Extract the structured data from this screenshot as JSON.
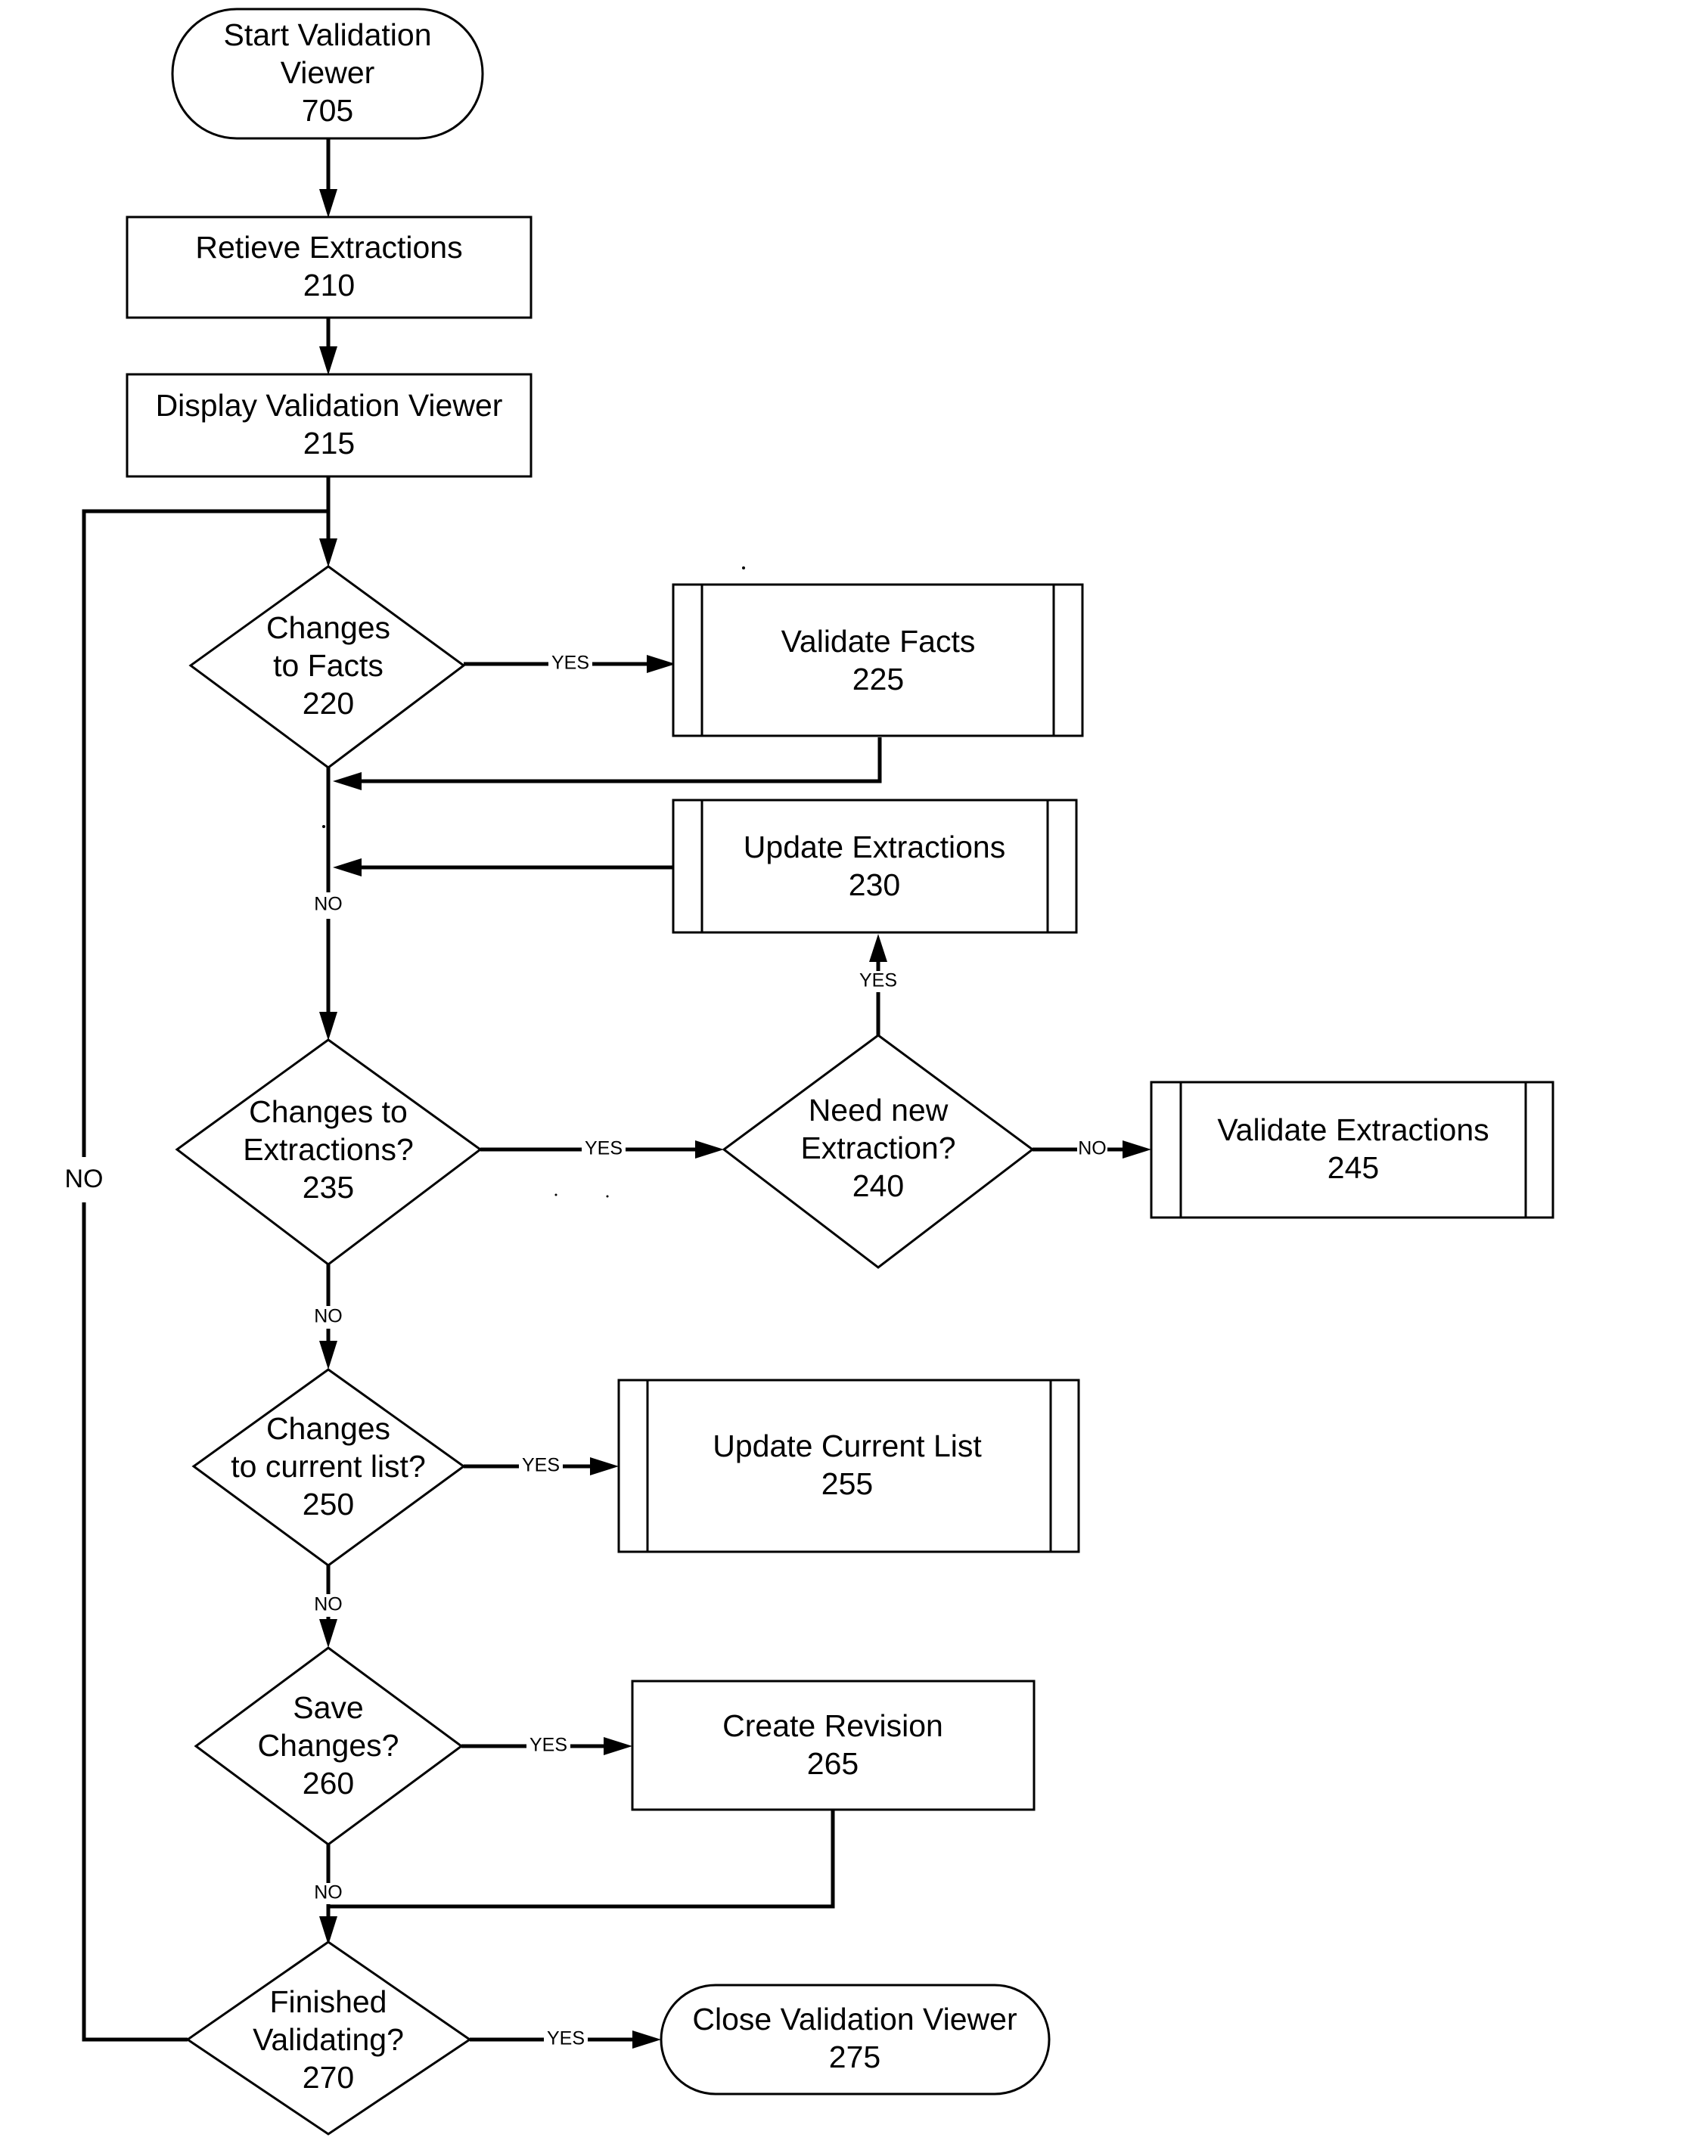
{
  "diagram": {
    "type": "flowchart",
    "nodes": {
      "start": {
        "id": "705",
        "shape": "terminator",
        "lines": [
          "Start Validation",
          "Viewer",
          "705"
        ]
      },
      "retrieve": {
        "id": "210",
        "shape": "process",
        "lines": [
          "Retieve Extractions",
          "210"
        ]
      },
      "display": {
        "id": "215",
        "shape": "process",
        "lines": [
          "Display Validation Viewer",
          "215"
        ]
      },
      "facts_q": {
        "id": "220",
        "shape": "decision",
        "lines": [
          "Changes",
          "to Facts",
          "220"
        ]
      },
      "validate_facts": {
        "id": "225",
        "shape": "predefined-process",
        "lines": [
          "Validate Facts",
          "225"
        ]
      },
      "update_extractions": {
        "id": "230",
        "shape": "predefined-process",
        "lines": [
          "Update Extractions",
          "230"
        ]
      },
      "extractions_q": {
        "id": "235",
        "shape": "decision",
        "lines": [
          "Changes to",
          "Extractions?",
          "235"
        ]
      },
      "need_new_q": {
        "id": "240",
        "shape": "decision",
        "lines": [
          "Need new",
          "Extraction?",
          "240"
        ]
      },
      "validate_extractions": {
        "id": "245",
        "shape": "predefined-process",
        "lines": [
          "Validate Extractions",
          "245"
        ]
      },
      "list_q": {
        "id": "250",
        "shape": "decision",
        "lines": [
          "Changes",
          "to current list?",
          "250"
        ]
      },
      "update_list": {
        "id": "255",
        "shape": "predefined-process",
        "lines": [
          "Update Current List",
          "255"
        ]
      },
      "save_q": {
        "id": "260",
        "shape": "decision",
        "lines": [
          "Save",
          "Changes?",
          "260"
        ]
      },
      "create_revision": {
        "id": "265",
        "shape": "process",
        "lines": [
          "Create Revision",
          "265"
        ]
      },
      "finished_q": {
        "id": "270",
        "shape": "decision",
        "lines": [
          "Finished",
          "Validating?",
          "270"
        ]
      },
      "close": {
        "id": "275",
        "shape": "terminator",
        "lines": [
          "Close Validation Viewer",
          "275"
        ]
      }
    },
    "edges": [
      {
        "from": "705",
        "to": "210",
        "label": ""
      },
      {
        "from": "210",
        "to": "215",
        "label": ""
      },
      {
        "from": "215",
        "to": "220",
        "label": ""
      },
      {
        "from": "220",
        "to": "225",
        "label": "YES"
      },
      {
        "from": "225",
        "to": "235",
        "label": ""
      },
      {
        "from": "220",
        "to": "235",
        "label": "NO"
      },
      {
        "from": "230",
        "to": "235",
        "label": ""
      },
      {
        "from": "235",
        "to": "240",
        "label": "YES"
      },
      {
        "from": "240",
        "to": "230",
        "label": "YES"
      },
      {
        "from": "240",
        "to": "245",
        "label": "NO"
      },
      {
        "from": "235",
        "to": "250",
        "label": "NO"
      },
      {
        "from": "250",
        "to": "255",
        "label": "YES"
      },
      {
        "from": "250",
        "to": "260",
        "label": "NO"
      },
      {
        "from": "260",
        "to": "265",
        "label": "YES"
      },
      {
        "from": "260",
        "to": "270",
        "label": "NO"
      },
      {
        "from": "265",
        "to": "270",
        "label": ""
      },
      {
        "from": "270",
        "to": "275",
        "label": "YES"
      },
      {
        "from": "270",
        "to": "220",
        "label": "NO"
      }
    ],
    "labels": {
      "yes": "YES",
      "no": "NO"
    }
  }
}
